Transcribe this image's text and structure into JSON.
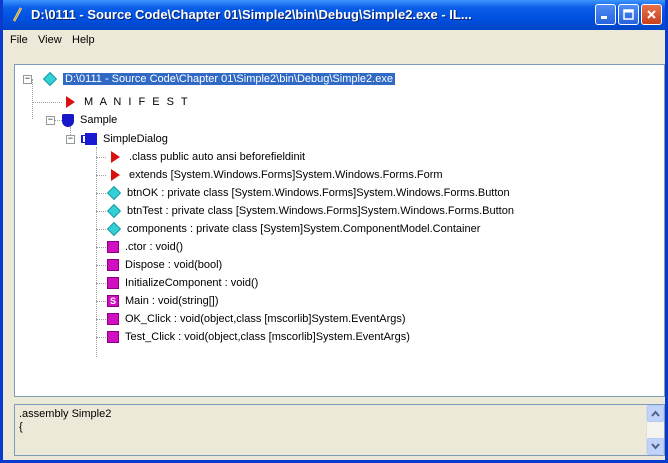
{
  "window": {
    "title": "D:\\0111 - Source Code\\Chapter 01\\Simple2\\bin\\Debug\\Simple2.exe - IL...",
    "title_color": "#0054e3"
  },
  "menu": {
    "items": [
      "File",
      "View",
      "Help"
    ]
  },
  "tree": {
    "root": {
      "label": "D:\\0111 - Source Code\\Chapter 01\\Simple2\\bin\\Debug\\Simple2.exe",
      "icon": "cyan-diamond-icon",
      "expanded": true,
      "selected": true
    },
    "manifest": {
      "label": "M A N I F E S T",
      "icon": "red-triangle-icon"
    },
    "namespace": {
      "label": "Sample",
      "icon": "namespace-shield-icon",
      "expanded": true
    },
    "class": {
      "label": "SimpleDialog",
      "icon": "class-icon",
      "expanded": true
    },
    "members": [
      {
        "label": ".class public auto ansi beforefieldinit",
        "icon": "red-triangle-icon"
      },
      {
        "label": "extends [System.Windows.Forms]System.Windows.Forms.Form",
        "icon": "red-triangle-icon"
      },
      {
        "label": "btnOK : private class [System.Windows.Forms]System.Windows.Forms.Button",
        "icon": "cyan-diamond-icon"
      },
      {
        "label": "btnTest : private class [System.Windows.Forms]System.Windows.Forms.Button",
        "icon": "cyan-diamond-icon"
      },
      {
        "label": "components : private class [System]System.ComponentModel.Container",
        "icon": "cyan-diamond-icon"
      },
      {
        "label": ".ctor : void()",
        "icon": "method-icon"
      },
      {
        "label": "Dispose : void(bool)",
        "icon": "method-icon"
      },
      {
        "label": "InitializeComponent : void()",
        "icon": "method-icon"
      },
      {
        "label": "Main : void(string[])",
        "icon": "static-method-icon"
      },
      {
        "label": "OK_Click : void(object,class [mscorlib]System.EventArgs)",
        "icon": "method-icon"
      },
      {
        "label": "Test_Click : void(object,class [mscorlib]System.EventArgs)",
        "icon": "method-icon"
      }
    ]
  },
  "output": {
    "text": ".assembly Simple2\n{"
  }
}
